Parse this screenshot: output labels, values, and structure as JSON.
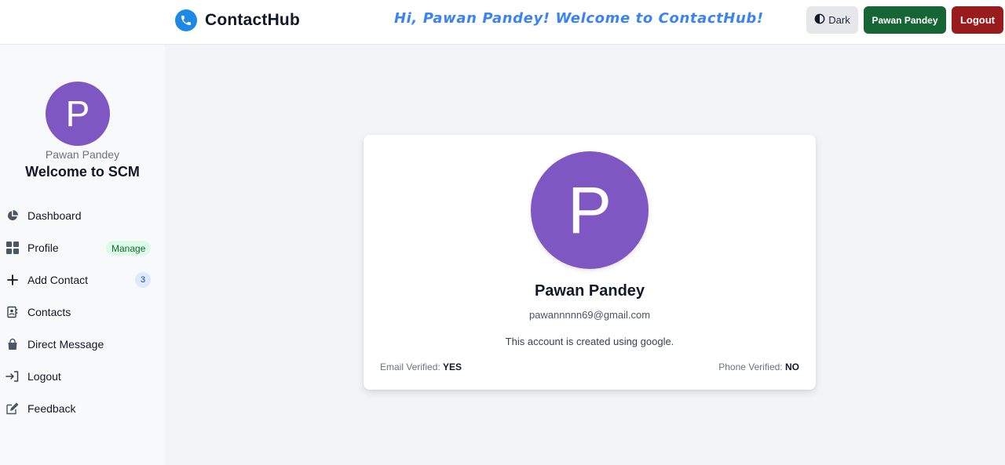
{
  "header": {
    "brand": "ContactHub",
    "welcome": "Hi, Pawan Pandey! Welcome to ContactHub!",
    "dark_label": "Dark",
    "user_button": "Pawan Pandey",
    "logout_button": "Logout"
  },
  "sidebar": {
    "avatar_initial": "P",
    "user_name": "Pawan Pandey",
    "welcome": "Welcome to SCM",
    "items": [
      {
        "label": "Dashboard",
        "icon": "pie-chart-icon"
      },
      {
        "label": "Profile",
        "icon": "grid-icon",
        "badge": "Manage"
      },
      {
        "label": "Add Contact",
        "icon": "plus-icon",
        "badge": "3"
      },
      {
        "label": "Contacts",
        "icon": "address-book-icon"
      },
      {
        "label": "Direct Message",
        "icon": "bag-icon"
      },
      {
        "label": "Logout",
        "icon": "logout-icon"
      },
      {
        "label": "Feedback",
        "icon": "edit-icon"
      }
    ]
  },
  "profile": {
    "avatar_initial": "P",
    "name": "Pawan Pandey",
    "email": "pawannnnn69@gmail.com",
    "note": "This account is created using google.",
    "email_verified_label": "Email Verified:",
    "email_verified_value": "YES",
    "phone_verified_label": "Phone Verified:",
    "phone_verified_value": "NO"
  },
  "colors": {
    "brand_blue": "#1e88e5",
    "welcome_blue": "#3b82f6",
    "avatar_purple": "#7e57c2",
    "user_button_green": "#166534",
    "logout_button_red": "#991b1b"
  }
}
